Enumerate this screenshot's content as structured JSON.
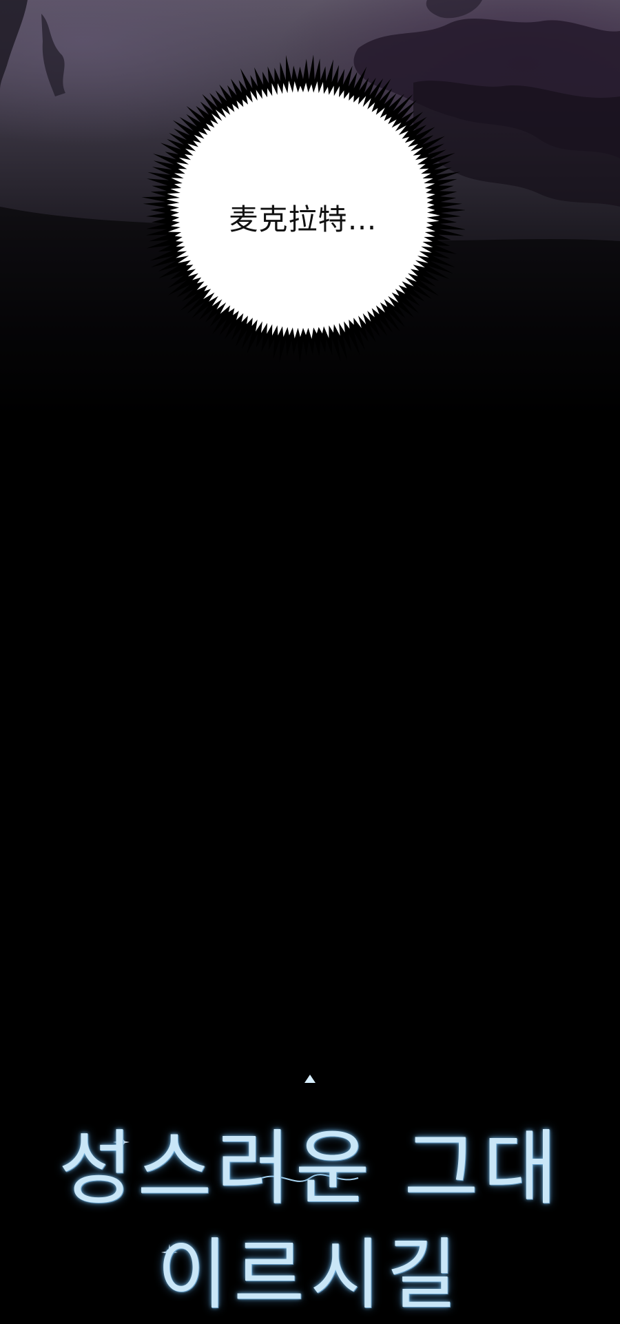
{
  "speech": {
    "text": "麦克拉特…"
  },
  "logo": {
    "line1": "성스러운 그대",
    "line2": "이르시길"
  },
  "colors": {
    "sky_top": "#5d5566",
    "background": "#000000",
    "bubble_fill": "#ffffff",
    "bubble_outline": "#000000",
    "logo_text": "#c9e6f7",
    "logo_glow": "#78bee9"
  }
}
